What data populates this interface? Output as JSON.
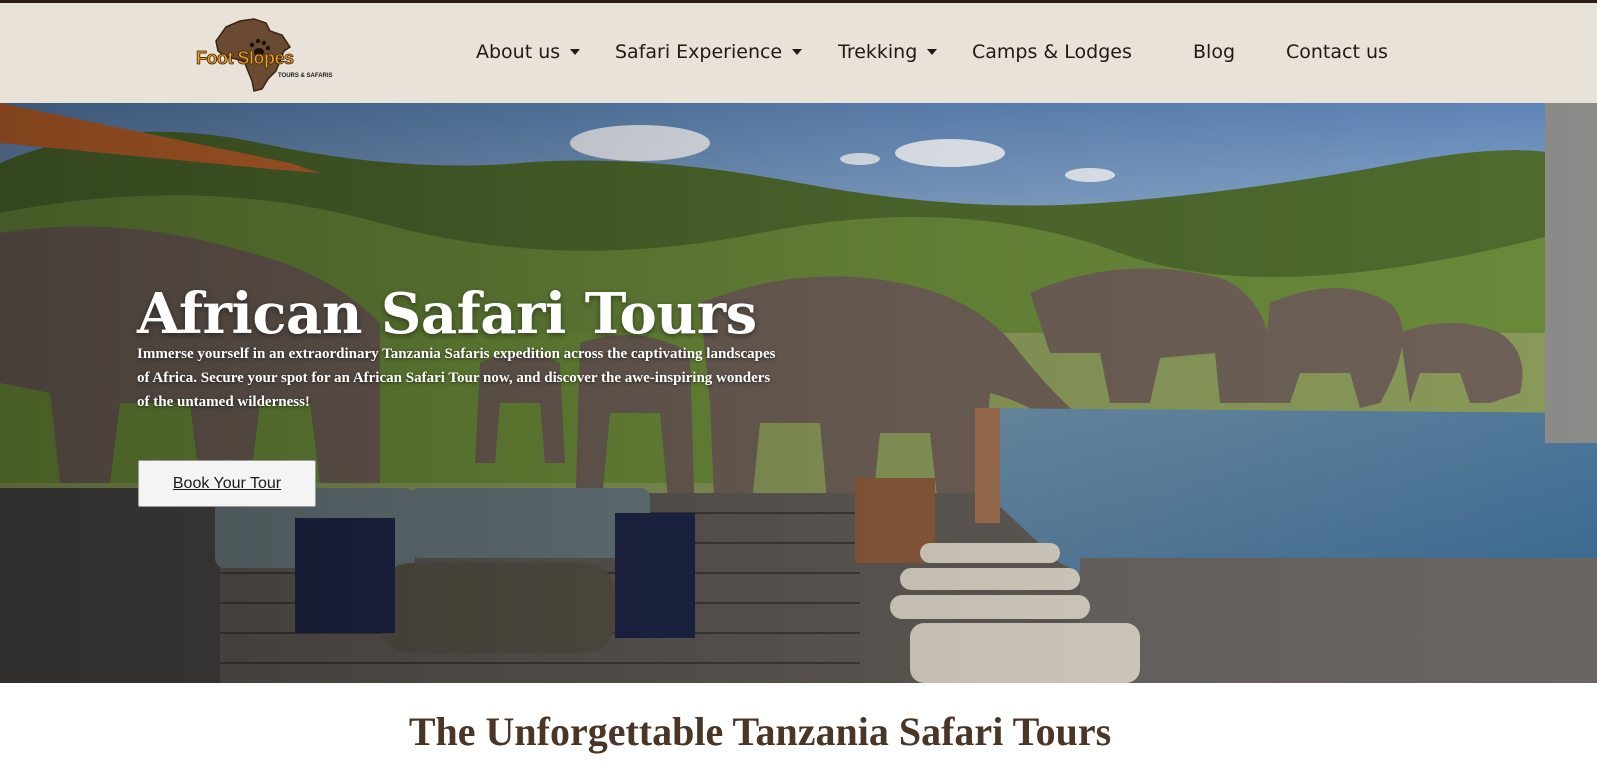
{
  "brand": {
    "logo_text": "Foot Slopes",
    "logo_subtext": "TOURS & SAFARIS"
  },
  "nav": {
    "items": [
      {
        "label": "About us",
        "has_dropdown": true
      },
      {
        "label": "Safari Experience",
        "has_dropdown": true
      },
      {
        "label": "Trekking",
        "has_dropdown": true
      },
      {
        "label": "Camps & Lodges",
        "has_dropdown": false
      },
      {
        "label": "Blog",
        "has_dropdown": false
      },
      {
        "label": "Contact us",
        "has_dropdown": false
      }
    ]
  },
  "hero": {
    "title": "African Safari Tours",
    "text": "Immerse yourself in an extraordinary Tanzania Safaris expedition across the captivating landscapes of Africa. Secure your spot for an African Safari Tour now, and discover the awe-inspiring wonders of the untamed wilderness!",
    "cta_label": "Book Your Tour"
  },
  "section": {
    "title": "The Unforgettable Tanzania Safari Tours"
  },
  "colors": {
    "header_bg": "#e8e2d9",
    "logo_orange": "#f2a11f",
    "logo_brown": "#6b4a33",
    "title_brown": "#4a3626"
  }
}
